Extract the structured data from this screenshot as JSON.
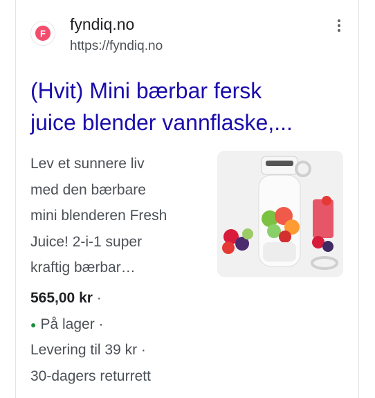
{
  "result": {
    "site_name": "fyndiq.no",
    "url": "https://fyndiq.no",
    "favicon_letter": "F",
    "title_line1": "(Hvit) Mini bærbar fersk",
    "title_line2": "juice blender vannflaske,...",
    "snippet_lines": [
      "Lev et sunnere liv",
      "med den bærbare",
      "mini blenderen Fresh",
      "Juice! 2-i-1 super",
      "kraftig bærbar…"
    ],
    "price": "565,00 kr",
    "stock": "På lager",
    "delivery": "Levering til 39 kr",
    "returns": "30-dagers returrett",
    "separator": "·"
  },
  "colors": {
    "title": "#1a0dab",
    "favicon": "#f24d6d",
    "stock_dot": "#1e8e3e"
  },
  "icons": {
    "favicon": "fyndiq-logo-icon",
    "menu": "more-vert-icon",
    "stock_dot": "green-dot-icon"
  }
}
